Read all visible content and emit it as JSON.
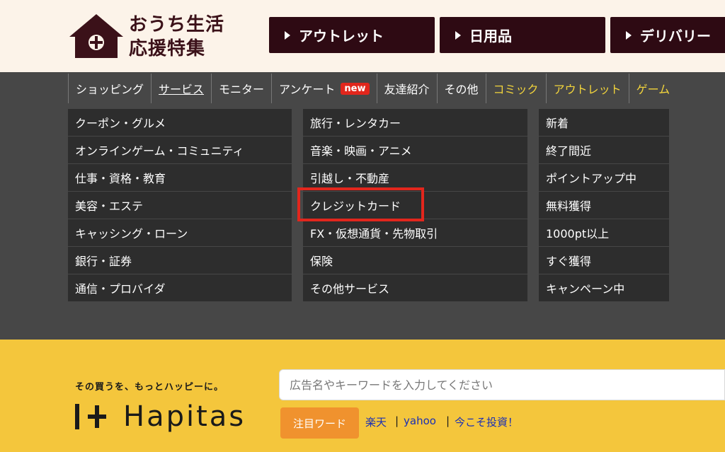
{
  "header": {
    "logo_line1": "おうち生活",
    "logo_line2": "応援特集",
    "buttons": [
      {
        "label": "アウトレット"
      },
      {
        "label": "日用品"
      },
      {
        "label": "デリバリー"
      }
    ]
  },
  "nav": {
    "items": [
      {
        "label": "ショッピング"
      },
      {
        "label": "サービス"
      },
      {
        "label": "モニター"
      },
      {
        "label": "アンケート",
        "badge": "new"
      },
      {
        "label": "友達紹介"
      },
      {
        "label": "その他"
      },
      {
        "label": "コミック"
      },
      {
        "label": "アウトレット"
      },
      {
        "label": "ゲーム"
      }
    ]
  },
  "dropdown": {
    "col1": [
      "クーポン・グルメ",
      "オンラインゲーム・コミュニティ",
      "仕事・資格・教育",
      "美容・エステ",
      "キャッシング・ローン",
      "銀行・証券",
      "通信・プロバイダ"
    ],
    "col2": [
      "旅行・レンタカー",
      "音楽・映画・アニメ",
      "引越し・不動産",
      "クレジットカード",
      "FX・仮想通貨・先物取引",
      "保険",
      "その他サービス"
    ],
    "col3": [
      "新着",
      "終了間近",
      "ポイントアップ中",
      "無料獲得",
      "1000pt以上",
      "すぐ獲得",
      "キャンペーン中"
    ]
  },
  "brand": {
    "tagline": "その買うを、もっとハッピーに。",
    "name": "Hapitas"
  },
  "search": {
    "placeholder": "広告名やキーワードを入力してください"
  },
  "hot": {
    "button_label": "注目ワード",
    "keywords": [
      "楽天",
      "yahoo",
      "今こそ投資！"
    ],
    "separator": "|"
  },
  "colors": {
    "header_bg": "#fcf3e9",
    "brand_dark": "#2e0a13",
    "nav_bg": "#474747",
    "cell_bg": "#2d2d2d",
    "accent_yellow": "#f4c63c",
    "highlight_red": "#e2261d",
    "hot_orange": "#f0922e",
    "link_blue": "#1a2fb5"
  }
}
